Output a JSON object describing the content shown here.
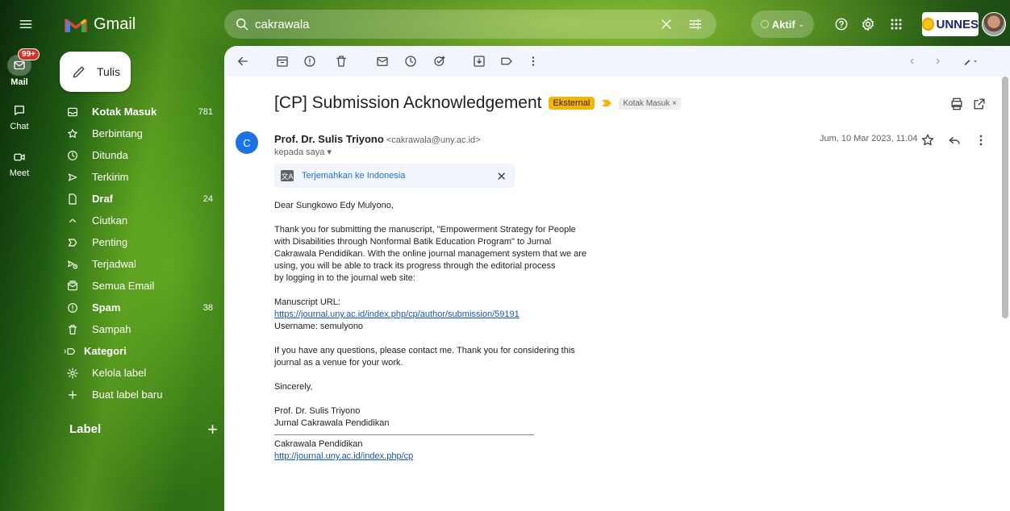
{
  "rail": {
    "mail_label": "Mail",
    "mail_badge": "99+",
    "chat_label": "Chat",
    "meet_label": "Meet"
  },
  "app": {
    "title": "Gmail"
  },
  "compose": {
    "label": "Tulis"
  },
  "nav": {
    "items": [
      {
        "label": "Kotak Masuk",
        "count": "781",
        "icon": "inbox-icon",
        "bold": true
      },
      {
        "label": "Berbintang",
        "count": "",
        "icon": "star-icon",
        "bold": false
      },
      {
        "label": "Ditunda",
        "count": "",
        "icon": "clock-icon",
        "bold": false
      },
      {
        "label": "Terkirim",
        "count": "",
        "icon": "send-icon",
        "bold": false
      },
      {
        "label": "Draf",
        "count": "24",
        "icon": "draft-icon",
        "bold": true
      },
      {
        "label": "Ciutkan",
        "count": "",
        "icon": "chevron-up-icon",
        "bold": false
      },
      {
        "label": "Penting",
        "count": "",
        "icon": "important-icon",
        "bold": false
      },
      {
        "label": "Terjadwal",
        "count": "",
        "icon": "scheduled-send-icon",
        "bold": false
      },
      {
        "label": "Semua Email",
        "count": "",
        "icon": "all-mail-icon",
        "bold": false
      },
      {
        "label": "Spam",
        "count": "38",
        "icon": "spam-icon",
        "bold": true
      },
      {
        "label": "Sampah",
        "count": "",
        "icon": "trash-icon",
        "bold": false
      },
      {
        "label": "Kategori",
        "count": "",
        "icon": "label-icon",
        "bold": true
      },
      {
        "label": "Kelola label",
        "count": "",
        "icon": "gear-icon",
        "bold": false
      },
      {
        "label": "Buat label baru",
        "count": "",
        "icon": "plus-icon",
        "bold": false
      }
    ],
    "labels_header": "Label"
  },
  "search": {
    "value": "cakrawala"
  },
  "status": {
    "label": "Aktif"
  },
  "org": {
    "name": "UNNES"
  },
  "email": {
    "subject": "[CP] Submission Acknowledgement",
    "external_chip": "Eksternal",
    "inbox_chip": "Kotak Masuk ×",
    "sender_avatar": "C",
    "sender_name": "Prof. Dr. Sulis Triyono",
    "sender_email": "<cakrawala@uny.ac.id>",
    "recipient": "kepada saya ▾",
    "date": "Jum, 10 Mar 2023, 11.04",
    "translate_label": "Terjemahkan ke Indonesia",
    "greeting": "Dear Sungkowo Edy Mulyono,",
    "para1_line1": "Thank you for submitting the manuscript, \"Empowerment Strategy for People",
    "para1_line2": "with Disabilities through Nonformal Batik Education Program\" to Jurnal",
    "para1_line3": "Cakrawala Pendidikan. With the online journal management system that we are",
    "para1_line4": "using, you will be able to track its progress through the editorial process",
    "para1_line5": "by logging in to the journal web site:",
    "url_label": "Manuscript URL:",
    "url": "https://journal.uny.ac.id/index.php/cp/author/submission/59191",
    "username": "Username: semulyono",
    "para2_line1": "If you have any questions, please contact me. Thank you for considering this",
    "para2_line2": "journal as a venue for your work.",
    "closing": "Sincerely,",
    "sig_name": "Prof. Dr. Sulis Triyono",
    "sig_org": "Jurnal Cakrawala Pendidikan",
    "footer_name": "Cakrawala Pendidikan",
    "footer_url": "http://journal.uny.ac.id/index.php/cp"
  },
  "colors": {
    "accent_blue": "#1a73e8",
    "external_chip": "#f6b502",
    "badge_red": "#d93025",
    "toolbar_bg": "#f2f6fc"
  }
}
